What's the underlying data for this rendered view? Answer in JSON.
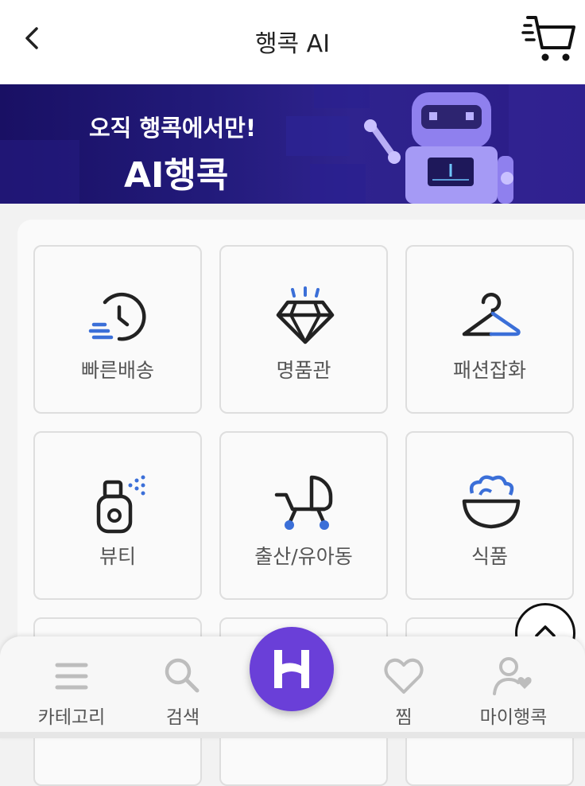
{
  "header": {
    "title": "행콕 AI",
    "back_icon": "chevron-left-icon",
    "cart_icon": "cart-icon"
  },
  "banner": {
    "line1": "오직 행콕에서만!",
    "line2": "AI행콕"
  },
  "categories": [
    {
      "label": "빠른배송",
      "icon": "fast-clock-icon"
    },
    {
      "label": "명품관",
      "icon": "diamond-icon"
    },
    {
      "label": "패션잡화",
      "icon": "hanger-icon"
    },
    {
      "label": "뷰티",
      "icon": "perfume-icon"
    },
    {
      "label": "출산/유아동",
      "icon": "stroller-icon"
    },
    {
      "label": "식품",
      "icon": "food-bowl-icon"
    }
  ],
  "tabbar": {
    "items": [
      {
        "label": "카테고리",
        "icon": "menu-icon"
      },
      {
        "label": "검색",
        "icon": "search-icon"
      },
      {
        "label": "찜",
        "icon": "heart-icon"
      },
      {
        "label": "마이행콕",
        "icon": "user-heart-icon"
      }
    ],
    "home_icon": "h-logo-icon"
  },
  "colors": {
    "accent": "#6a3fd8",
    "icon_blue": "#3b6fd8",
    "banner_dark": "#191064"
  }
}
